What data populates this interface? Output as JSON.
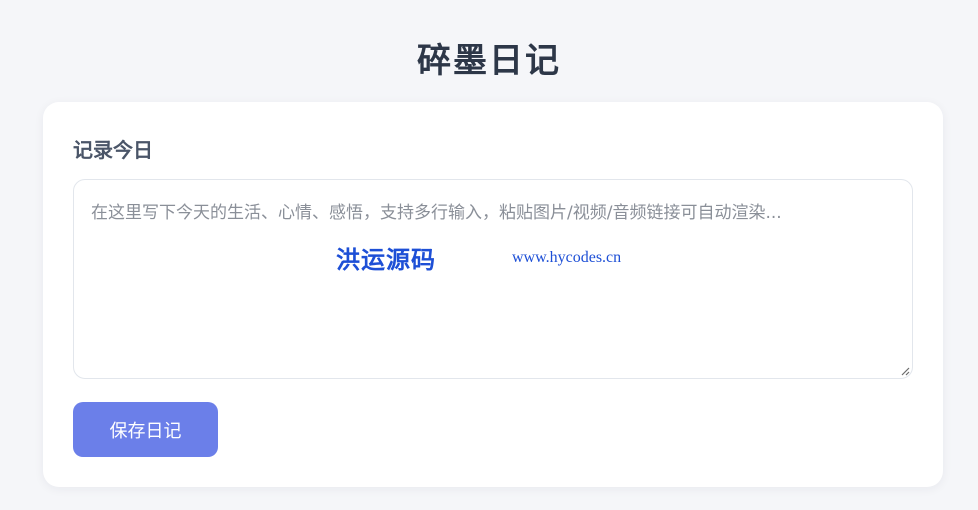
{
  "app": {
    "title": "碎墨日记"
  },
  "editor": {
    "section_title": "记录今日",
    "placeholder": "在这里写下今天的生活、心情、感悟，支持多行输入，粘贴图片/视频/音频链接可自动渲染...",
    "value": ""
  },
  "watermark": {
    "name": "洪运源码",
    "url": "www.hycodes.cn"
  },
  "actions": {
    "save_label": "保存日记"
  },
  "colors": {
    "background": "#f5f6f9",
    "card": "#ffffff",
    "accent": "#6b7fe9",
    "watermark": "#1d4fd6"
  }
}
